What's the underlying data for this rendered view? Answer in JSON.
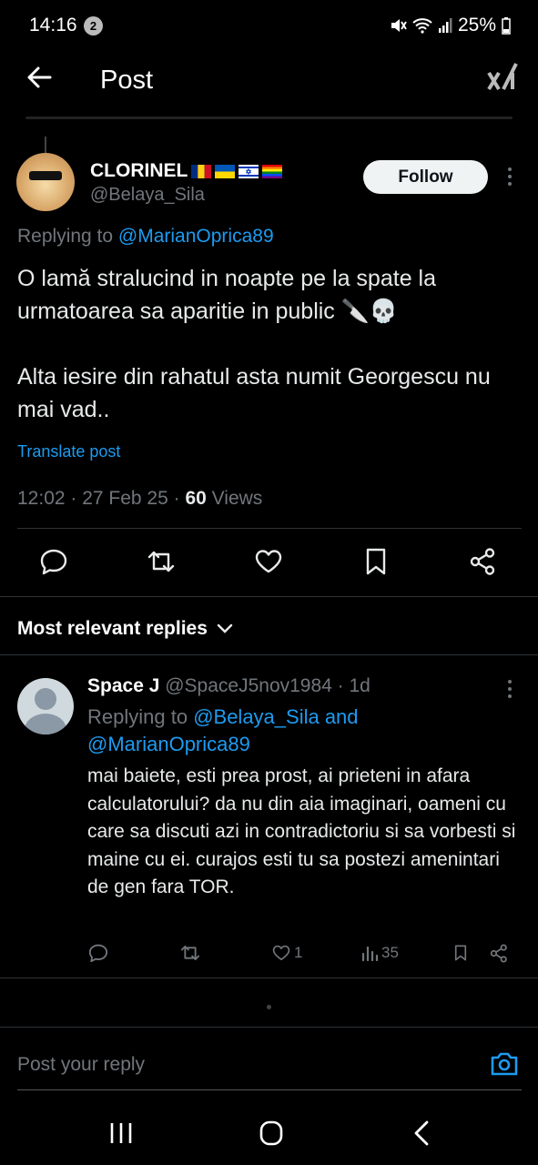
{
  "status_bar": {
    "time": "14:16",
    "notif_count": "2",
    "battery": "25%"
  },
  "header": {
    "title": "Post"
  },
  "post": {
    "author_name": "CLORINEL",
    "author_handle": "@Belaya_Sila",
    "follow_label": "Follow",
    "replying_prefix": "Replying to",
    "replying_to": "@MarianOprica89",
    "paragraph1": "O lamă stralucind in noapte pe la spate la urmatoarea sa aparitie in public 🔪💀",
    "paragraph2": "Alta iesire din rahatul asta numit Georgescu nu mai vad..",
    "translate_label": "Translate post",
    "timestamp": "12:02 · 27 Feb 25 · ",
    "views_count": "60",
    "views_label": " Views"
  },
  "replies_section": {
    "label": "Most relevant replies"
  },
  "reply": {
    "name": "Space J",
    "handle_time": " @SpaceJ5nov1984 · 1d",
    "replying_prefix": "Replying to ",
    "replying_to_1": "@Belaya_Sila and",
    "replying_to_2": "@MarianOprica89",
    "body": "mai baiete, esti prea prost, ai prieteni in afara calculatorului? da nu din aia imaginari, oameni cu care sa discuti azi in contradictoriu si sa vorbesti si maine cu ei. curajos esti tu sa postezi amenintari de gen fara TOR.",
    "likes": "1",
    "views": "35"
  },
  "composer": {
    "placeholder": "Post your reply"
  },
  "colors": {
    "background": "#000000",
    "accent": "#1d9bf0",
    "muted": "#71767b",
    "text": "#e7e9ea"
  },
  "icons": [
    "back-arrow-icon",
    "grok-icon",
    "reply-icon",
    "repost-icon",
    "like-icon",
    "bookmark-icon",
    "share-icon",
    "chevron-down-icon",
    "views-icon",
    "camera-icon",
    "recents-icon",
    "home-icon",
    "back-icon"
  ]
}
